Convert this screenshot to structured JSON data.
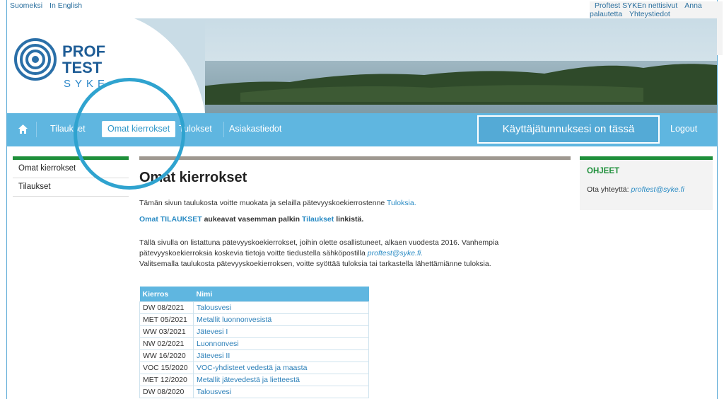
{
  "top_links": {
    "lang_fi": "Suomeksi",
    "lang_en": "In English",
    "site": "Proftest SYKEn nettisivut",
    "feedback": "Anna palautetta",
    "contact": "Yhteystiedot"
  },
  "logo": {
    "line1": "PROF",
    "line2": "TEST",
    "line3": "SYKE"
  },
  "nav": {
    "home_icon": "home-icon",
    "orders": "Tilaukset",
    "my_rounds": "Omat kierrokset",
    "results": "Tulokset",
    "customer": "Asiakastiedot",
    "user_box": "Käyttäjätunnuksesi on tässä",
    "logout": "Logout"
  },
  "sidebar": {
    "items": [
      {
        "label": "Omat kierrokset"
      },
      {
        "label": "Tilaukset"
      }
    ]
  },
  "main": {
    "title": "Omat kierrokset",
    "intro": "Tämän sivun taulukosta voitte muokata ja selailla pätevyyskoekierrostenne",
    "intro_link": "Tuloksia.",
    "orders_prefix": "Omat TILAUKSET",
    "orders_mid": "aukeavat vasemman palkin",
    "orders_link": "Tilaukset",
    "orders_suffix": "linkistä.",
    "desc_line1": "Tällä sivulla on listattuna pätevyyskoekierrokset, joihin olette osallistuneet, alkaen vuodesta 2016. Vanhempia",
    "desc_line2a": "pätevyyskoekierroksia koskevia tietoja voitte tiedustella sähköpostilla",
    "desc_email": "proftest@syke.fi.",
    "desc_line3": "Valitsemalla taulukosta pätevyyskoekierroksen, voitte syöttää tuloksia tai tarkastella lähettämiänne tuloksia."
  },
  "table": {
    "headers": [
      "Kierros",
      "Nimi"
    ],
    "rows": [
      [
        "DW 08/2021",
        "Talousvesi"
      ],
      [
        "MET 05/2021",
        "Metallit luonnonvesistä"
      ],
      [
        "WW 03/2021",
        "Jätevesi I"
      ],
      [
        "NW 02/2021",
        "Luonnonvesi"
      ],
      [
        "WW 16/2020",
        "Jätevesi II"
      ],
      [
        "VOC 15/2020",
        "VOC-yhdisteet vedestä ja maasta"
      ],
      [
        "MET 12/2020",
        "Metallit jätevedestä ja lietteestä"
      ],
      [
        "DW 08/2020",
        "Talousvesi"
      ]
    ]
  },
  "help": {
    "title": "OHJEET",
    "contact_label": "Ota yhteyttä:",
    "contact_email": "proftest@syke.fi"
  },
  "colors": {
    "accent": "#5fb6e0",
    "green": "#1e8f3a",
    "link": "#2a8bc4"
  }
}
